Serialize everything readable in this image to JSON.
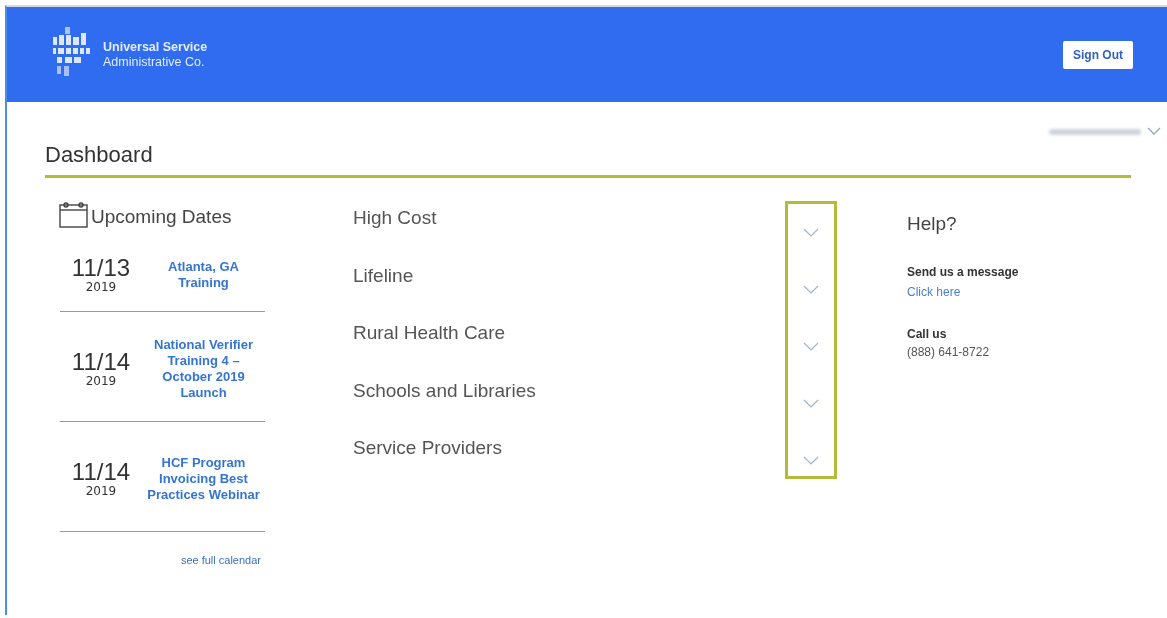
{
  "header": {
    "brand_line_1": "Universal Service",
    "brand_line_2": "Administrative Co.",
    "sign_out": "Sign Out"
  },
  "page_title": "Dashboard",
  "upcoming": {
    "title": "Upcoming Dates",
    "events": [
      {
        "date": "11/13",
        "year": "2019",
        "title": "Atlanta, GA Training"
      },
      {
        "date": "11/14",
        "year": "2019",
        "title": "National Verifier Training 4 – October 2019 Launch"
      },
      {
        "date": "11/14",
        "year": "2019",
        "title": "HCF Program Invoicing Best Practices Webinar"
      }
    ],
    "link": "see full calendar"
  },
  "programs": [
    {
      "name": "High Cost",
      "expanded": false
    },
    {
      "name": "Lifeline",
      "expanded": false
    },
    {
      "name": "Rural Health Care",
      "expanded": false
    },
    {
      "name": "Schools and Libraries",
      "expanded": false
    },
    {
      "name": "Service Providers",
      "expanded": false
    }
  ],
  "help": {
    "title": "Help?",
    "message_label": "Send us a message",
    "message_link": "Click here",
    "call_label": "Call us",
    "phone": "(888) 641-8722"
  }
}
